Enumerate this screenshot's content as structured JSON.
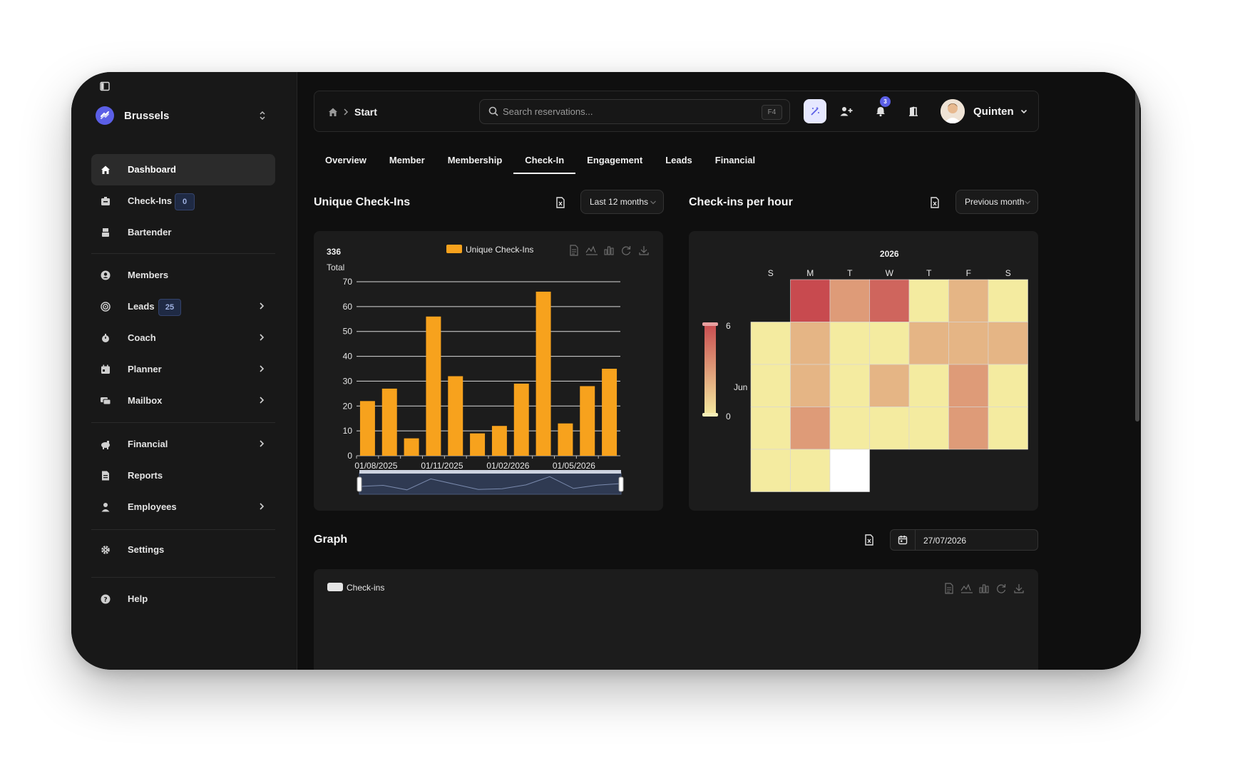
{
  "workspace": {
    "name": "Brussels"
  },
  "sidebar": {
    "items": [
      {
        "label": "Dashboard",
        "icon": "home-icon",
        "active": true
      },
      {
        "label": "Check-Ins",
        "icon": "checkin-icon",
        "badge": "0"
      },
      {
        "label": "Bartender",
        "icon": "bartender-icon"
      },
      {
        "label": "Members",
        "icon": "members-icon"
      },
      {
        "label": "Leads",
        "icon": "leads-icon",
        "badge": "25",
        "submenu": true
      },
      {
        "label": "Coach",
        "icon": "coach-icon",
        "submenu": true
      },
      {
        "label": "Planner",
        "icon": "planner-icon",
        "submenu": true
      },
      {
        "label": "Mailbox",
        "icon": "mailbox-icon",
        "submenu": true
      },
      {
        "label": "Financial",
        "icon": "financial-icon",
        "submenu": true
      },
      {
        "label": "Reports",
        "icon": "reports-icon"
      },
      {
        "label": "Employees",
        "icon": "employees-icon",
        "submenu": true
      },
      {
        "label": "Settings",
        "icon": "settings-icon"
      },
      {
        "label": "Help",
        "icon": "help-icon"
      }
    ]
  },
  "header": {
    "breadcrumb": "Start",
    "search_placeholder": "Search reservations...",
    "search_shortcut": "F4",
    "notifications_count": "3",
    "user_name": "Quinten"
  },
  "tabs": [
    "Overview",
    "Member",
    "Membership",
    "Check-In",
    "Engagement",
    "Leads",
    "Financial"
  ],
  "active_tab": "Check-In",
  "unique_checkins": {
    "title": "Unique Check-Ins",
    "range_select": "Last 12 months",
    "total_value": "336",
    "total_label": "Total"
  },
  "checkins_per_hour": {
    "title": "Check-ins per hour",
    "range_select": "Previous month"
  },
  "graph": {
    "title": "Graph",
    "date": "27/07/2026",
    "legend": "Check-ins"
  },
  "colors": {
    "accent": "#5b5fe6",
    "bar": "#f7a21d",
    "heat_low": "#f4eba0",
    "heat_high": "#c84a4f"
  },
  "chart_data": [
    {
      "type": "bar",
      "title": "",
      "series": [
        {
          "name": "Unique Check-Ins",
          "values": [
            22,
            27,
            7,
            56,
            32,
            9,
            12,
            29,
            66,
            13,
            28,
            35
          ]
        }
      ],
      "x_tick_labels": [
        "01/08/2025",
        "01/11/2025",
        "01/02/2026",
        "01/05/2026"
      ],
      "yticks": [
        0,
        10,
        20,
        30,
        40,
        50,
        60,
        70
      ],
      "ylim": [
        0,
        70
      ],
      "legend": "top-center",
      "grid": true
    },
    {
      "type": "heatmap",
      "title": "2026",
      "weekdays": [
        "S",
        "M",
        "T",
        "W",
        "T",
        "F",
        "S"
      ],
      "month_label": "Jun",
      "scale_min": 0,
      "scale_max": 6,
      "weeks": [
        [
          null,
          6,
          3,
          5,
          0,
          2,
          0
        ],
        [
          0,
          2,
          0,
          0,
          2,
          2,
          2
        ],
        [
          0,
          2,
          0,
          2,
          0,
          3,
          0
        ],
        [
          0,
          3,
          0,
          0,
          0,
          3,
          0
        ],
        [
          0,
          0,
          -1,
          null,
          null,
          null,
          null
        ]
      ]
    }
  ]
}
